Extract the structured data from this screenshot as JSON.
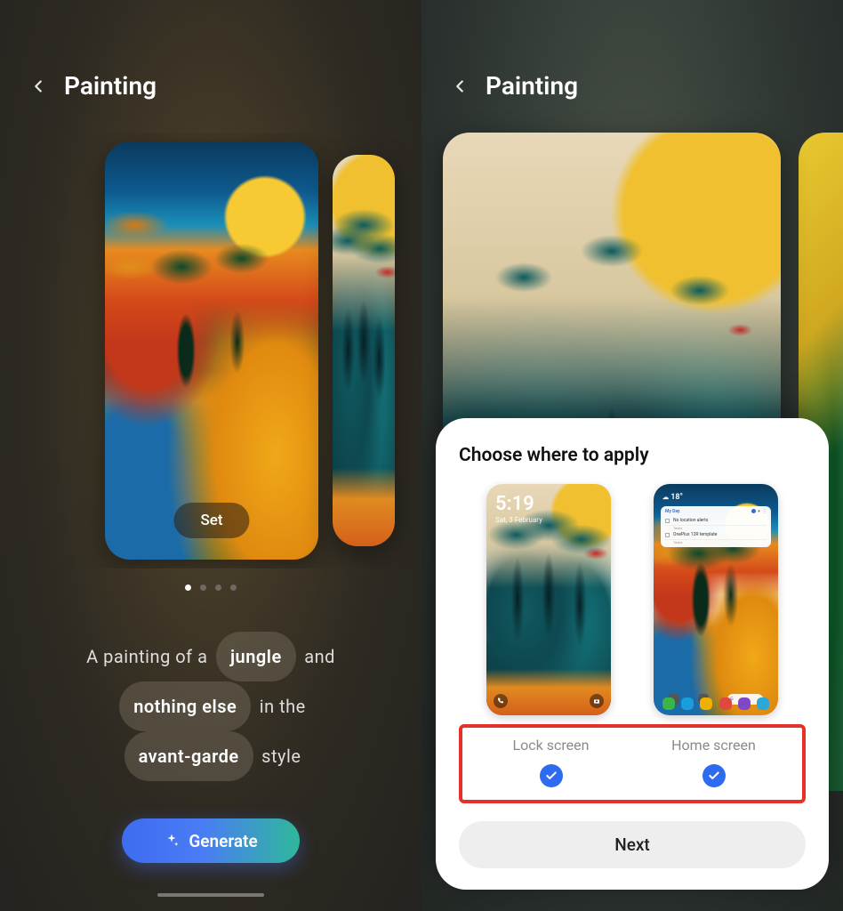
{
  "left": {
    "title": "Painting",
    "set_label": "Set",
    "dots": {
      "count": 4,
      "active": 0
    },
    "prompt": {
      "t1": "A  painting  of  a",
      "chip1": "jungle",
      "t2": "and",
      "chip2": "nothing else",
      "t3": "in  the",
      "chip3": "avant-garde",
      "t4": "style"
    },
    "generate_label": "Generate"
  },
  "right": {
    "title": "Painting",
    "sheet": {
      "title": "Choose where to apply",
      "lock": {
        "time": "5:19",
        "date": "Sat, 3 February",
        "label": "Lock screen",
        "checked": true
      },
      "home": {
        "temp": "18°",
        "widget_title": "My Day",
        "task1": "No location alerts",
        "task1_sub": "Tasks",
        "task2": "OnePlus 12R template",
        "task2_sub": "Tasks",
        "label": "Home screen",
        "checked": true
      },
      "next_label": "Next"
    }
  }
}
